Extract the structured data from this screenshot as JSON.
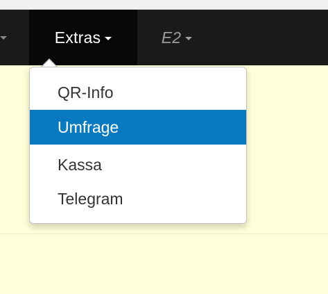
{
  "navbar": {
    "items": [
      {
        "label": "Extras",
        "active": true
      },
      {
        "label": "E2",
        "active": false
      }
    ]
  },
  "dropdown": {
    "items": [
      {
        "label": "QR-Info",
        "highlighted": false
      },
      {
        "label": "Umfrage",
        "highlighted": true
      },
      {
        "label": "Kassa",
        "highlighted": false
      },
      {
        "label": "Telegram",
        "highlighted": false
      }
    ]
  },
  "colors": {
    "navbar_bg": "#1a1a1a",
    "page_bg": "#ffffd9",
    "highlight": "#0a7ac0"
  }
}
